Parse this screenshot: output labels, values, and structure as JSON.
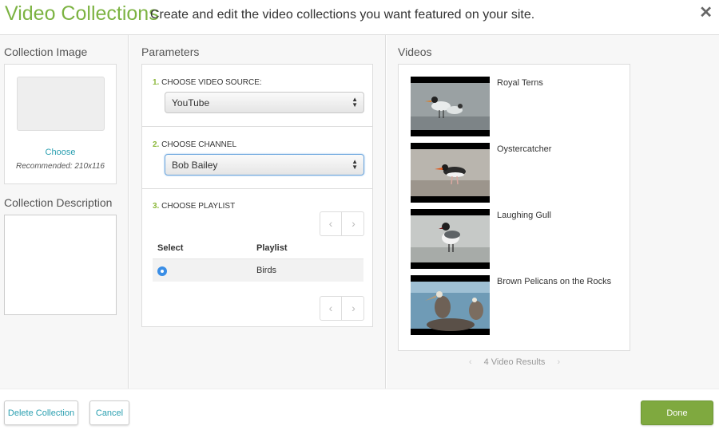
{
  "header": {
    "title": "Video Collections",
    "subtitle": "Create and edit the video collections you want featured on your site.",
    "close_label": "✕"
  },
  "left": {
    "image_title": "Collection Image",
    "choose_label": "Choose",
    "recommended": "Recommended: 210x116",
    "description_title": "Collection Description",
    "description_value": ""
  },
  "params": {
    "title": "Parameters",
    "step1": {
      "num": "1.",
      "label": "Choose Video Source:",
      "value": "YouTube"
    },
    "step2": {
      "num": "2.",
      "label": "Choose Channel",
      "value": "Bob Bailey"
    },
    "step3": {
      "num": "3.",
      "label": "Choose Playlist"
    },
    "playlist": {
      "col_select": "Select",
      "col_playlist": "Playlist",
      "rows": [
        {
          "name": "Birds",
          "selected": true
        }
      ]
    },
    "pager": {
      "prev": "‹",
      "next": "›"
    }
  },
  "videos": {
    "title": "Videos",
    "items": [
      {
        "title": "Royal Terns",
        "thumb": "royal-terns"
      },
      {
        "title": "Oystercatcher",
        "thumb": "oystercatcher"
      },
      {
        "title": "Laughing Gull",
        "thumb": "laughing-gull"
      },
      {
        "title": "Brown Pelicans on the Rocks",
        "thumb": "brown-pelicans"
      }
    ],
    "results": "4 Video Results",
    "prev": "‹",
    "next": "›"
  },
  "footer": {
    "delete_label": "Delete Collection",
    "cancel_label": "Cancel",
    "done_label": "Done"
  },
  "colors": {
    "accent": "#7cb342",
    "link": "#2a9fb0",
    "done": "#7fa93f",
    "radio": "#3a8ee6"
  }
}
